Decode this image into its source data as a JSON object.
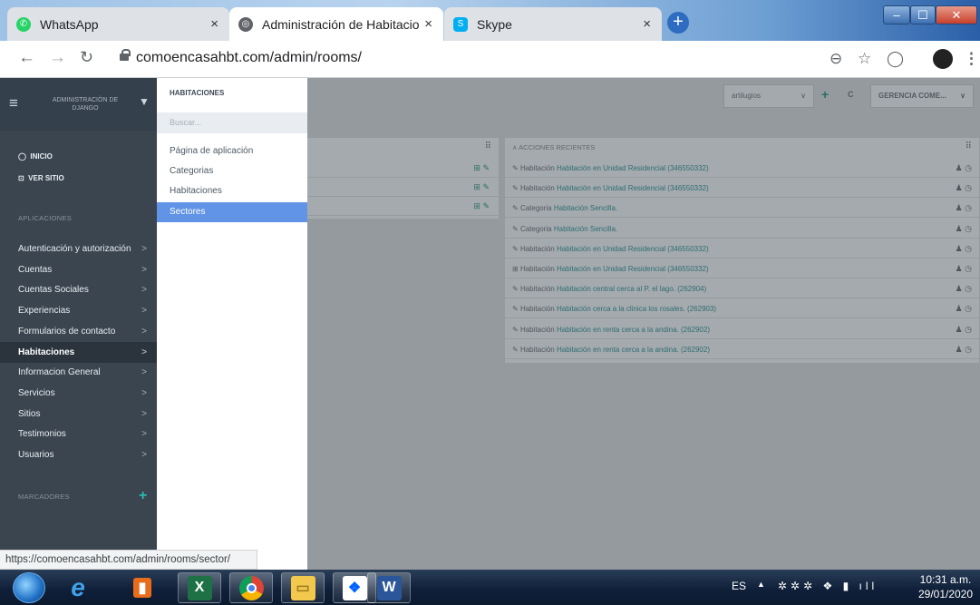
{
  "browser": {
    "tabs": [
      {
        "title": "WhatsApp",
        "icon": "whatsapp-icon",
        "active": false
      },
      {
        "title": "Administración de Habitaciones |",
        "icon": "globe-icon",
        "active": true
      },
      {
        "title": "Skype",
        "icon": "skype-icon",
        "active": false
      }
    ],
    "new_tab": "+",
    "close": "×",
    "url": "comoencasahbt.com/admin/rooms/",
    "status_url": "https://comoencasahbt.com/admin/rooms/sector/"
  },
  "sidebar": {
    "header": "ADMINISTRACIÓN DE DJANGO",
    "top_links": [
      {
        "label": "INICIO",
        "icon": "circle-icon"
      },
      {
        "label": "VER SITIO",
        "icon": "external-link-icon"
      }
    ],
    "apps_title": "APLICACIONES",
    "apps": [
      "Autenticación y autorización",
      "Cuentas",
      "Cuentas Sociales",
      "Experiencias",
      "Formularios de contacto",
      "Habitaciones",
      "Informacion General",
      "Servicios",
      "Sitios",
      "Testimonios",
      "Usuarios"
    ],
    "active_app": "Habitaciones",
    "bookmarks_title": "MARCADORES",
    "bookmarks_add": "+"
  },
  "submenu": {
    "title": "HABITACIONES",
    "search_placeholder": "Buscar...",
    "items": [
      "Página de aplicación",
      "Categorias",
      "Habitaciones",
      "Sectores"
    ],
    "active": "Sectores"
  },
  "toolbar": {
    "select": "artilugios",
    "add": "+",
    "refresh": "C",
    "account": "GERENCIA COME..."
  },
  "recent": {
    "title": "ACCIONES RECIENTES",
    "rows": [
      {
        "icon": "edit-icon",
        "type": "Habitación",
        "link": "Habitación en Unidad Residencial (346550332)"
      },
      {
        "icon": "edit-icon",
        "type": "Habitación",
        "link": "Habitación en Unidad Residencial (346550332)"
      },
      {
        "icon": "edit-icon",
        "type": "Categoria",
        "link": "Habitación Sencilla."
      },
      {
        "icon": "edit-icon",
        "type": "Categoria",
        "link": "Habitación Sencilla."
      },
      {
        "icon": "edit-icon",
        "type": "Habitación",
        "link": "Habitación en Unidad Residencial (346550332)"
      },
      {
        "icon": "add-icon",
        "type": "Habitación",
        "link": "Habitación en Unidad Residencial (346550332)"
      },
      {
        "icon": "edit-icon",
        "type": "Habitación",
        "link": "Habitación central cerca al P. el lago. (262904)"
      },
      {
        "icon": "edit-icon",
        "type": "Habitación",
        "link": "Habitación cerca a la clinica los rosales. (262903)"
      },
      {
        "icon": "edit-icon",
        "type": "Habitación",
        "link": "Habitación en renta cerca a la andina. (262902)"
      },
      {
        "icon": "edit-icon",
        "type": "Habitación",
        "link": "Habitación en renta cerca a la andina. (262902)"
      }
    ]
  },
  "taskbar": {
    "lang": "ES",
    "time": "10:31 a.m.",
    "date": "29/01/2020"
  }
}
